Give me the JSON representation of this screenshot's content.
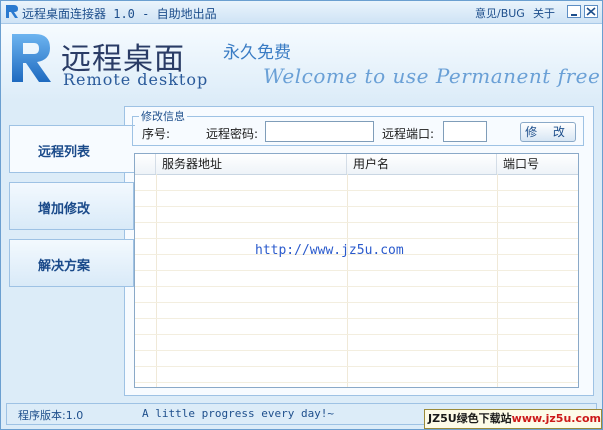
{
  "window": {
    "title": "远程桌面连接器 1.0 - 自助地出品",
    "feedback_link": "意见/BUG",
    "about_link": "关于"
  },
  "banner": {
    "logo_cn": "远程桌面",
    "logo_en": "Remote desktop",
    "free_cn": "永久免费",
    "welcome_en": "Welcome to use  Permanent free"
  },
  "nav": {
    "items": [
      {
        "label": "远程列表",
        "active": true
      },
      {
        "label": "增加修改",
        "active": false
      },
      {
        "label": "解决方案",
        "active": false
      }
    ]
  },
  "edit_form": {
    "legend": "修改信息",
    "seq_label": "序号:",
    "password_label": "远程密码:",
    "password_value": "",
    "port_label": "远程端口:",
    "port_value": "",
    "edit_button": "修 改"
  },
  "table": {
    "columns": [
      "",
      "服务器地址",
      "用户名",
      "端口号"
    ],
    "rows": []
  },
  "watermark": "http://www.jz5u.com",
  "status": {
    "version": "程序版本:1.0",
    "slogan": "A little progress every day!~",
    "site_badge_prefix": "JZ5U绿色下载站",
    "site_badge_url": "www.jz5u.com"
  },
  "colors": {
    "accent": "#1e4f8c",
    "background": "#dcecf8",
    "panel": "#f7fbff"
  }
}
